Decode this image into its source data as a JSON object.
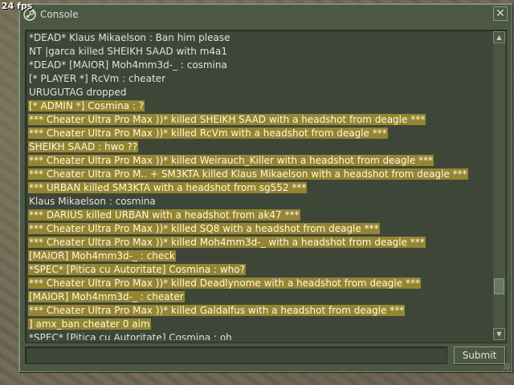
{
  "hud": {
    "fps": "24 fps"
  },
  "window": {
    "title": "Console",
    "close_label": "✕",
    "submit_label": "Submit",
    "input_value": ""
  },
  "colors": {
    "highlight": "#948532",
    "window_bg": "#4c5844"
  },
  "log": [
    {
      "text": "*DEAD* Klaus Mikaelson : Ban him please",
      "highlight": false
    },
    {
      "text": "NT |garca killed SHEIKH SAAD with m4a1",
      "highlight": false
    },
    {
      "text": "*DEAD* [MAIOR] Moh4mm3d-_ : cosmina",
      "highlight": false
    },
    {
      "text": "[* PLAYER *] RcVm : cheater",
      "highlight": false
    },
    {
      "text": "URUGUTAG dropped",
      "highlight": false
    },
    {
      "text": "[* ADMIN *] Cosmina :  ?",
      "highlight": true
    },
    {
      "text": "*** Cheater Ultra Pro Max ))* killed SHEIKH SAAD with a headshot from deagle ***",
      "highlight": true
    },
    {
      "text": "*** Cheater Ultra Pro Max ))* killed RcVm with a headshot from deagle ***",
      "highlight": true
    },
    {
      "text": "SHEIKH SAAD :  hwo ??",
      "highlight": true
    },
    {
      "text": "*** Cheater Ultra Pro Max ))* killed Weirauch_Killer with a headshot from deagle ***",
      "highlight": true
    },
    {
      "text": "*** Cheater Ultra Pro M.. + SM3KTA killed Klaus Mikaelson with a headshot from deagle ***",
      "highlight": true
    },
    {
      "text": "*** URBAN killed SM3KTA with a headshot from sg552 ***",
      "highlight": true
    },
    {
      "text": "Klaus Mikaelson : cosmina",
      "highlight": false
    },
    {
      "text": "*** DARIUS killed URBAN with a headshot from ak47 ***",
      "highlight": true
    },
    {
      "text": "*** Cheater Ultra Pro Max ))* killed SQ8 with a headshot from deagle ***",
      "highlight": true
    },
    {
      "text": "*** Cheater Ultra Pro Max ))* killed Moh4mm3d-_ with a headshot from deagle ***",
      "highlight": true
    },
    {
      "text": "[MAIOR] Moh4mm3d-_ : check",
      "highlight": true
    },
    {
      "text": "*SPEC* [Pitica cu Autoritate] Cosmina : who?",
      "highlight": true
    },
    {
      "text": "*** Cheater Ultra Pro Max ))* killed Deadlynome with a headshot from deagle ***",
      "highlight": true
    },
    {
      "text": "[MAIOR] Moh4mm3d-_ : cheater",
      "highlight": true
    },
    {
      "text": "*** Cheater Ultra Pro Max ))* killed Galdalfus with a headshot from deagle ***",
      "highlight": true
    },
    {
      "text": "] amx_ban cheater 0 aim",
      "highlight": true
    },
    {
      "text": "*SPEC* [Pitica cu Autoritate] Cosmina : oh",
      "highlight": false
    }
  ]
}
